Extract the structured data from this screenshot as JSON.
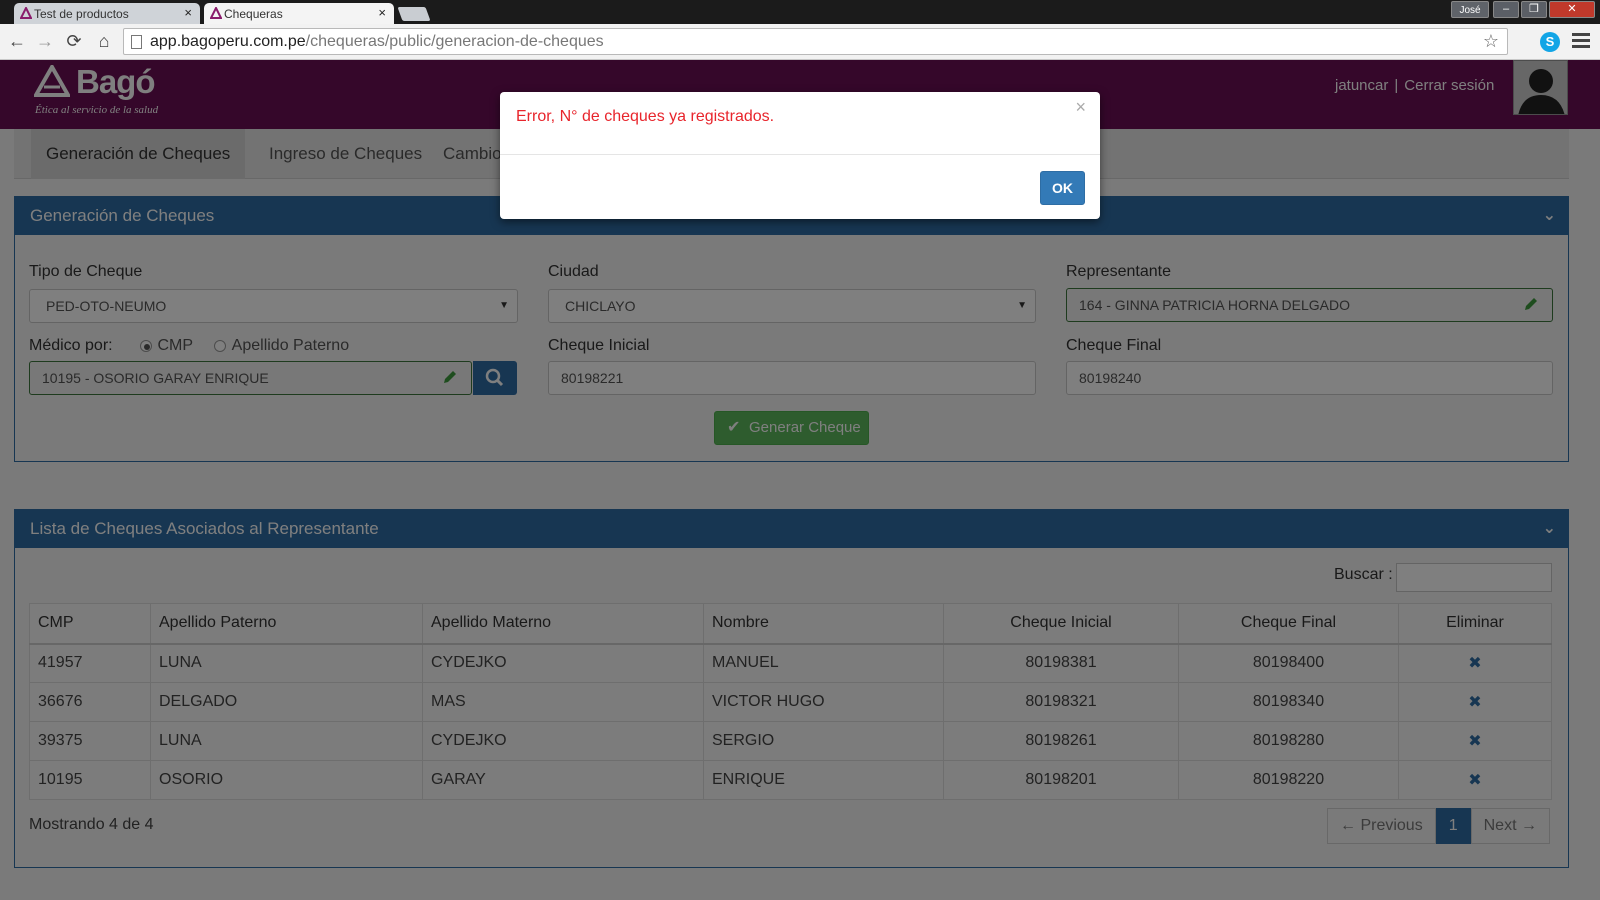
{
  "browser": {
    "tabs": [
      {
        "label": "Test de productos",
        "active": false
      },
      {
        "label": "Chequeras",
        "active": true
      }
    ],
    "user_badge": "José",
    "url_host": "app.bagoperu.com.pe",
    "url_path": "/chequeras/public/generacion-de-cheques"
  },
  "header": {
    "brand": "Bagó",
    "tagline": "Ética al servicio de la salud",
    "username": "jatuncar",
    "separator": "|",
    "logout": "Cerrar sesión",
    "colors": {
      "brand": "#6b0f54"
    }
  },
  "nav": {
    "tabs": [
      "Generación de Cheques",
      "Ingreso de Cheques",
      "Cambio d"
    ]
  },
  "generation_panel": {
    "title": "Generación de Cheques",
    "tipo_label": "Tipo de Cheque",
    "tipo_value": "PED-OTO-NEUMO",
    "ciudad_label": "Ciudad",
    "ciudad_value": "CHICLAYO",
    "representante_label": "Representante",
    "representante_value": "164 - GINNA PATRICIA HORNA DELGADO",
    "medico_label": "Médico por:",
    "radio_cmp": "CMP",
    "radio_apellido": "Apellido Paterno",
    "medico_value": "10195 - OSORIO GARAY ENRIQUE",
    "cheque_inicial_label": "Cheque Inicial",
    "cheque_inicial_value": "80198221",
    "cheque_final_label": "Cheque Final",
    "cheque_final_value": "80198240",
    "generate_button": "Generar Cheque"
  },
  "list_panel": {
    "title": "Lista de Cheques Asociados al Representante",
    "search_label": "Buscar :",
    "columns": [
      "CMP",
      "Apellido Paterno",
      "Apellido Materno",
      "Nombre",
      "Cheque Inicial",
      "Cheque Final",
      "Eliminar"
    ],
    "rows": [
      {
        "cmp": "41957",
        "paterno": "LUNA",
        "materno": "CYDEJKO",
        "nombre": "MANUEL",
        "inicial": "80198381",
        "final": "80198400"
      },
      {
        "cmp": "36676",
        "paterno": "DELGADO",
        "materno": "MAS",
        "nombre": "VICTOR HUGO",
        "inicial": "80198321",
        "final": "80198340"
      },
      {
        "cmp": "39375",
        "paterno": "LUNA",
        "materno": "CYDEJKO",
        "nombre": "SERGIO",
        "inicial": "80198261",
        "final": "80198280"
      },
      {
        "cmp": "10195",
        "paterno": "OSORIO",
        "materno": "GARAY",
        "nombre": "ENRIQUE",
        "inicial": "80198201",
        "final": "80198220"
      }
    ],
    "showing": "Mostrando 4 de 4",
    "pager": {
      "previous": "← Previous",
      "page": "1",
      "next": "Next →"
    }
  },
  "modal": {
    "message": "Error, N° de cheques ya registrados.",
    "ok_label": "OK",
    "close_glyph": "×"
  }
}
